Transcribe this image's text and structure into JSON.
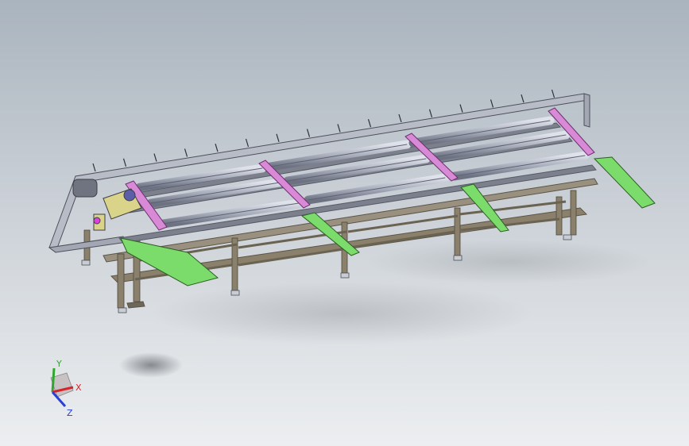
{
  "viewport": {
    "background_top": "#aab4be",
    "background_bottom": "#eceef0"
  },
  "model": {
    "description_icon": "conveyor-assembly",
    "frame_color": "#8a806c",
    "roller_color": "#a9aebd",
    "bracket_color": "#d88ad6",
    "chute_color": "#7bdc6b",
    "motor_color": "#d9d48a"
  },
  "triad": {
    "x_label": "X",
    "y_label": "Y",
    "z_label": "Z",
    "x_color": "#d6252a",
    "y_color": "#2ea82e",
    "z_color": "#2a3fd6"
  }
}
